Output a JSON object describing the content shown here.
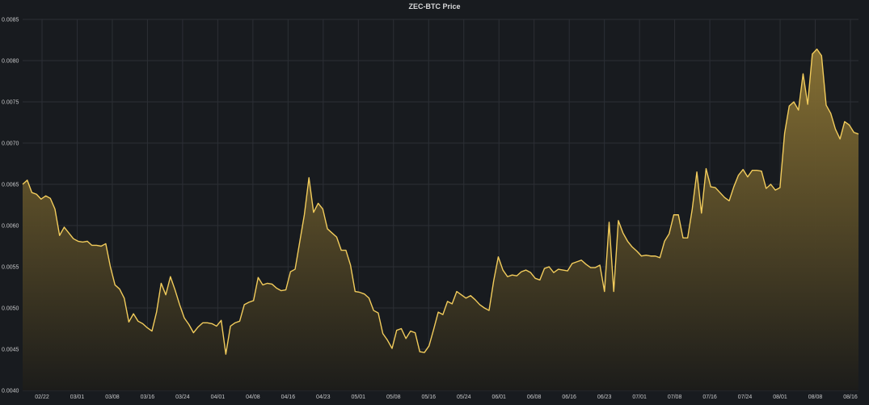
{
  "colors": {
    "background": "#181b1f",
    "grid": "#2c2f35",
    "line": "#f2cc5c",
    "fill_top": "#8a7334",
    "fill_bottom": "#1c1c1a",
    "text": "#d8d9da"
  },
  "chart_data": {
    "type": "area",
    "title": "ZEC-BTC Price",
    "xlabel": "",
    "ylabel": "",
    "ylim": [
      0.004,
      0.0085
    ],
    "y_ticks": [
      "0.0040",
      "0.0045",
      "0.0050",
      "0.0055",
      "0.0060",
      "0.0065",
      "0.0070",
      "0.0075",
      "0.0080",
      "0.0085"
    ],
    "x_ticks": [
      "02/22",
      "03/01",
      "03/08",
      "03/16",
      "03/24",
      "04/01",
      "04/08",
      "04/16",
      "04/23",
      "05/01",
      "05/08",
      "05/16",
      "05/24",
      "06/01",
      "06/08",
      "06/16",
      "06/23",
      "07/01",
      "07/08",
      "07/16",
      "07/24",
      "08/01",
      "08/08",
      "08/16"
    ],
    "grid": true,
    "legend": "none",
    "series": [
      {
        "values": [
          0.0065,
          0.00655,
          0.0064,
          0.00638,
          0.00632,
          0.00636,
          0.00633,
          0.0062,
          0.00588,
          0.00598,
          0.00591,
          0.00584,
          0.00581,
          0.0058,
          0.00581,
          0.00576,
          0.00576,
          0.00575,
          0.00578,
          0.0055,
          0.00528,
          0.00523,
          0.00512,
          0.00483,
          0.00493,
          0.00484,
          0.00481,
          0.00476,
          0.00472,
          0.00495,
          0.0053,
          0.00516,
          0.00538,
          0.00522,
          0.00504,
          0.00488,
          0.0048,
          0.0047,
          0.00477,
          0.00482,
          0.00482,
          0.00481,
          0.00478,
          0.00485,
          0.00444,
          0.00478,
          0.00482,
          0.00484,
          0.00504,
          0.00507,
          0.00509,
          0.00537,
          0.00528,
          0.0053,
          0.00529,
          0.00524,
          0.00521,
          0.00522,
          0.00544,
          0.00547,
          0.0058,
          0.00613,
          0.00658,
          0.00616,
          0.00627,
          0.0062,
          0.00596,
          0.00591,
          0.00586,
          0.0057,
          0.0057,
          0.00552,
          0.0052,
          0.00519,
          0.00517,
          0.00512,
          0.00497,
          0.00494,
          0.00469,
          0.00461,
          0.00451,
          0.00473,
          0.00475,
          0.00463,
          0.00472,
          0.0047,
          0.00447,
          0.00446,
          0.00454,
          0.00474,
          0.00495,
          0.00492,
          0.00508,
          0.00505,
          0.0052,
          0.00516,
          0.00512,
          0.00515,
          0.0051,
          0.00504,
          0.005,
          0.00497,
          0.00533,
          0.00562,
          0.00546,
          0.00538,
          0.0054,
          0.00539,
          0.00544,
          0.00546,
          0.00543,
          0.00536,
          0.00534,
          0.00548,
          0.0055,
          0.00543,
          0.00547,
          0.00546,
          0.00545,
          0.00554,
          0.00556,
          0.00558,
          0.00553,
          0.00549,
          0.00549,
          0.00552,
          0.0052,
          0.00604,
          0.0052,
          0.00606,
          0.00591,
          0.00581,
          0.00574,
          0.00569,
          0.00563,
          0.00564,
          0.00563,
          0.00563,
          0.00561,
          0.00581,
          0.0059,
          0.00613,
          0.00613,
          0.00585,
          0.00585,
          0.0062,
          0.00665,
          0.00615,
          0.00669,
          0.00647,
          0.00646,
          0.0064,
          0.00634,
          0.0063,
          0.00647,
          0.00661,
          0.00668,
          0.00659,
          0.00667,
          0.00667,
          0.00666,
          0.00645,
          0.0065,
          0.00643,
          0.00646,
          0.00712,
          0.00745,
          0.0075,
          0.0074,
          0.00784,
          0.00747,
          0.00808,
          0.00814,
          0.00806,
          0.00746,
          0.00736,
          0.00717,
          0.00705,
          0.00726,
          0.00722,
          0.00713,
          0.00711
        ]
      }
    ]
  }
}
